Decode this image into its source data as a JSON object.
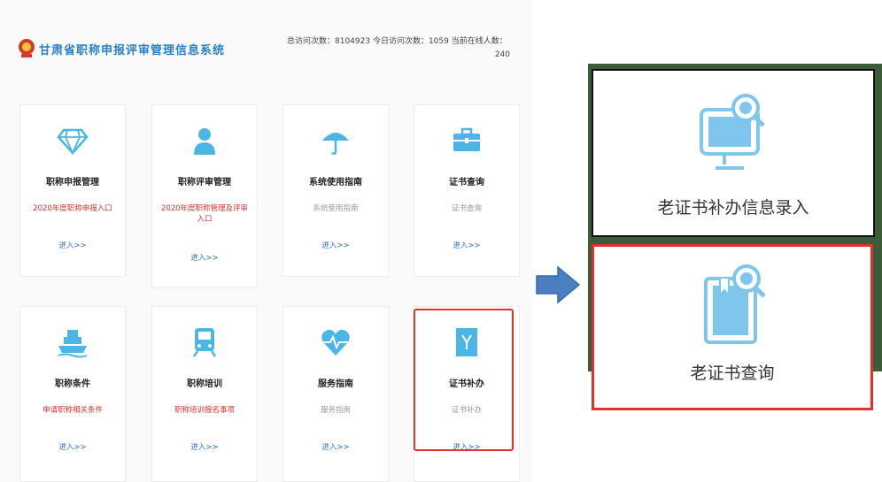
{
  "header": {
    "title": "甘肃省职称申报评审管理信息系统",
    "stats_line1": "总访问次数：8104923   今日访问次数：1059   当前在线人数：",
    "stats_line2": "240"
  },
  "cards": [
    {
      "title": "职称申报管理",
      "sub": "2020年度职称申报入口",
      "enter": "进入>>",
      "icon": "diamond-icon"
    },
    {
      "title": "职称评审管理",
      "sub": "2020年度职称管理及评审入口",
      "enter": "进入>>",
      "icon": "user-icon"
    },
    {
      "title": "系统使用指南",
      "sub": "系统使用指南",
      "enter": "进入>>",
      "icon": "umbrella-icon"
    },
    {
      "title": "证书查询",
      "sub": "证书查询",
      "enter": "进入>>",
      "icon": "briefcase-icon"
    },
    {
      "title": "职称条件",
      "sub": "申请职称相关条件",
      "enter": "进入>>",
      "icon": "ship-icon"
    },
    {
      "title": "职称培训",
      "sub": "职称培训报名事项",
      "enter": "进入>>",
      "icon": "train-icon"
    },
    {
      "title": "服务指南",
      "sub": "服务指南",
      "enter": "进入>>",
      "icon": "heart-pulse-icon"
    },
    {
      "title": "证书补办",
      "sub": "证书补办",
      "enter": "进入>>",
      "icon": "certificate-icon"
    }
  ],
  "zoom_panels": {
    "panel1_label": "老证书补办信息录入",
    "panel2_label": "老证书查询"
  },
  "colors": {
    "accent": "#4bb5e6",
    "title_blue": "#2a7fc9",
    "highlight_red": "#e0322a"
  }
}
